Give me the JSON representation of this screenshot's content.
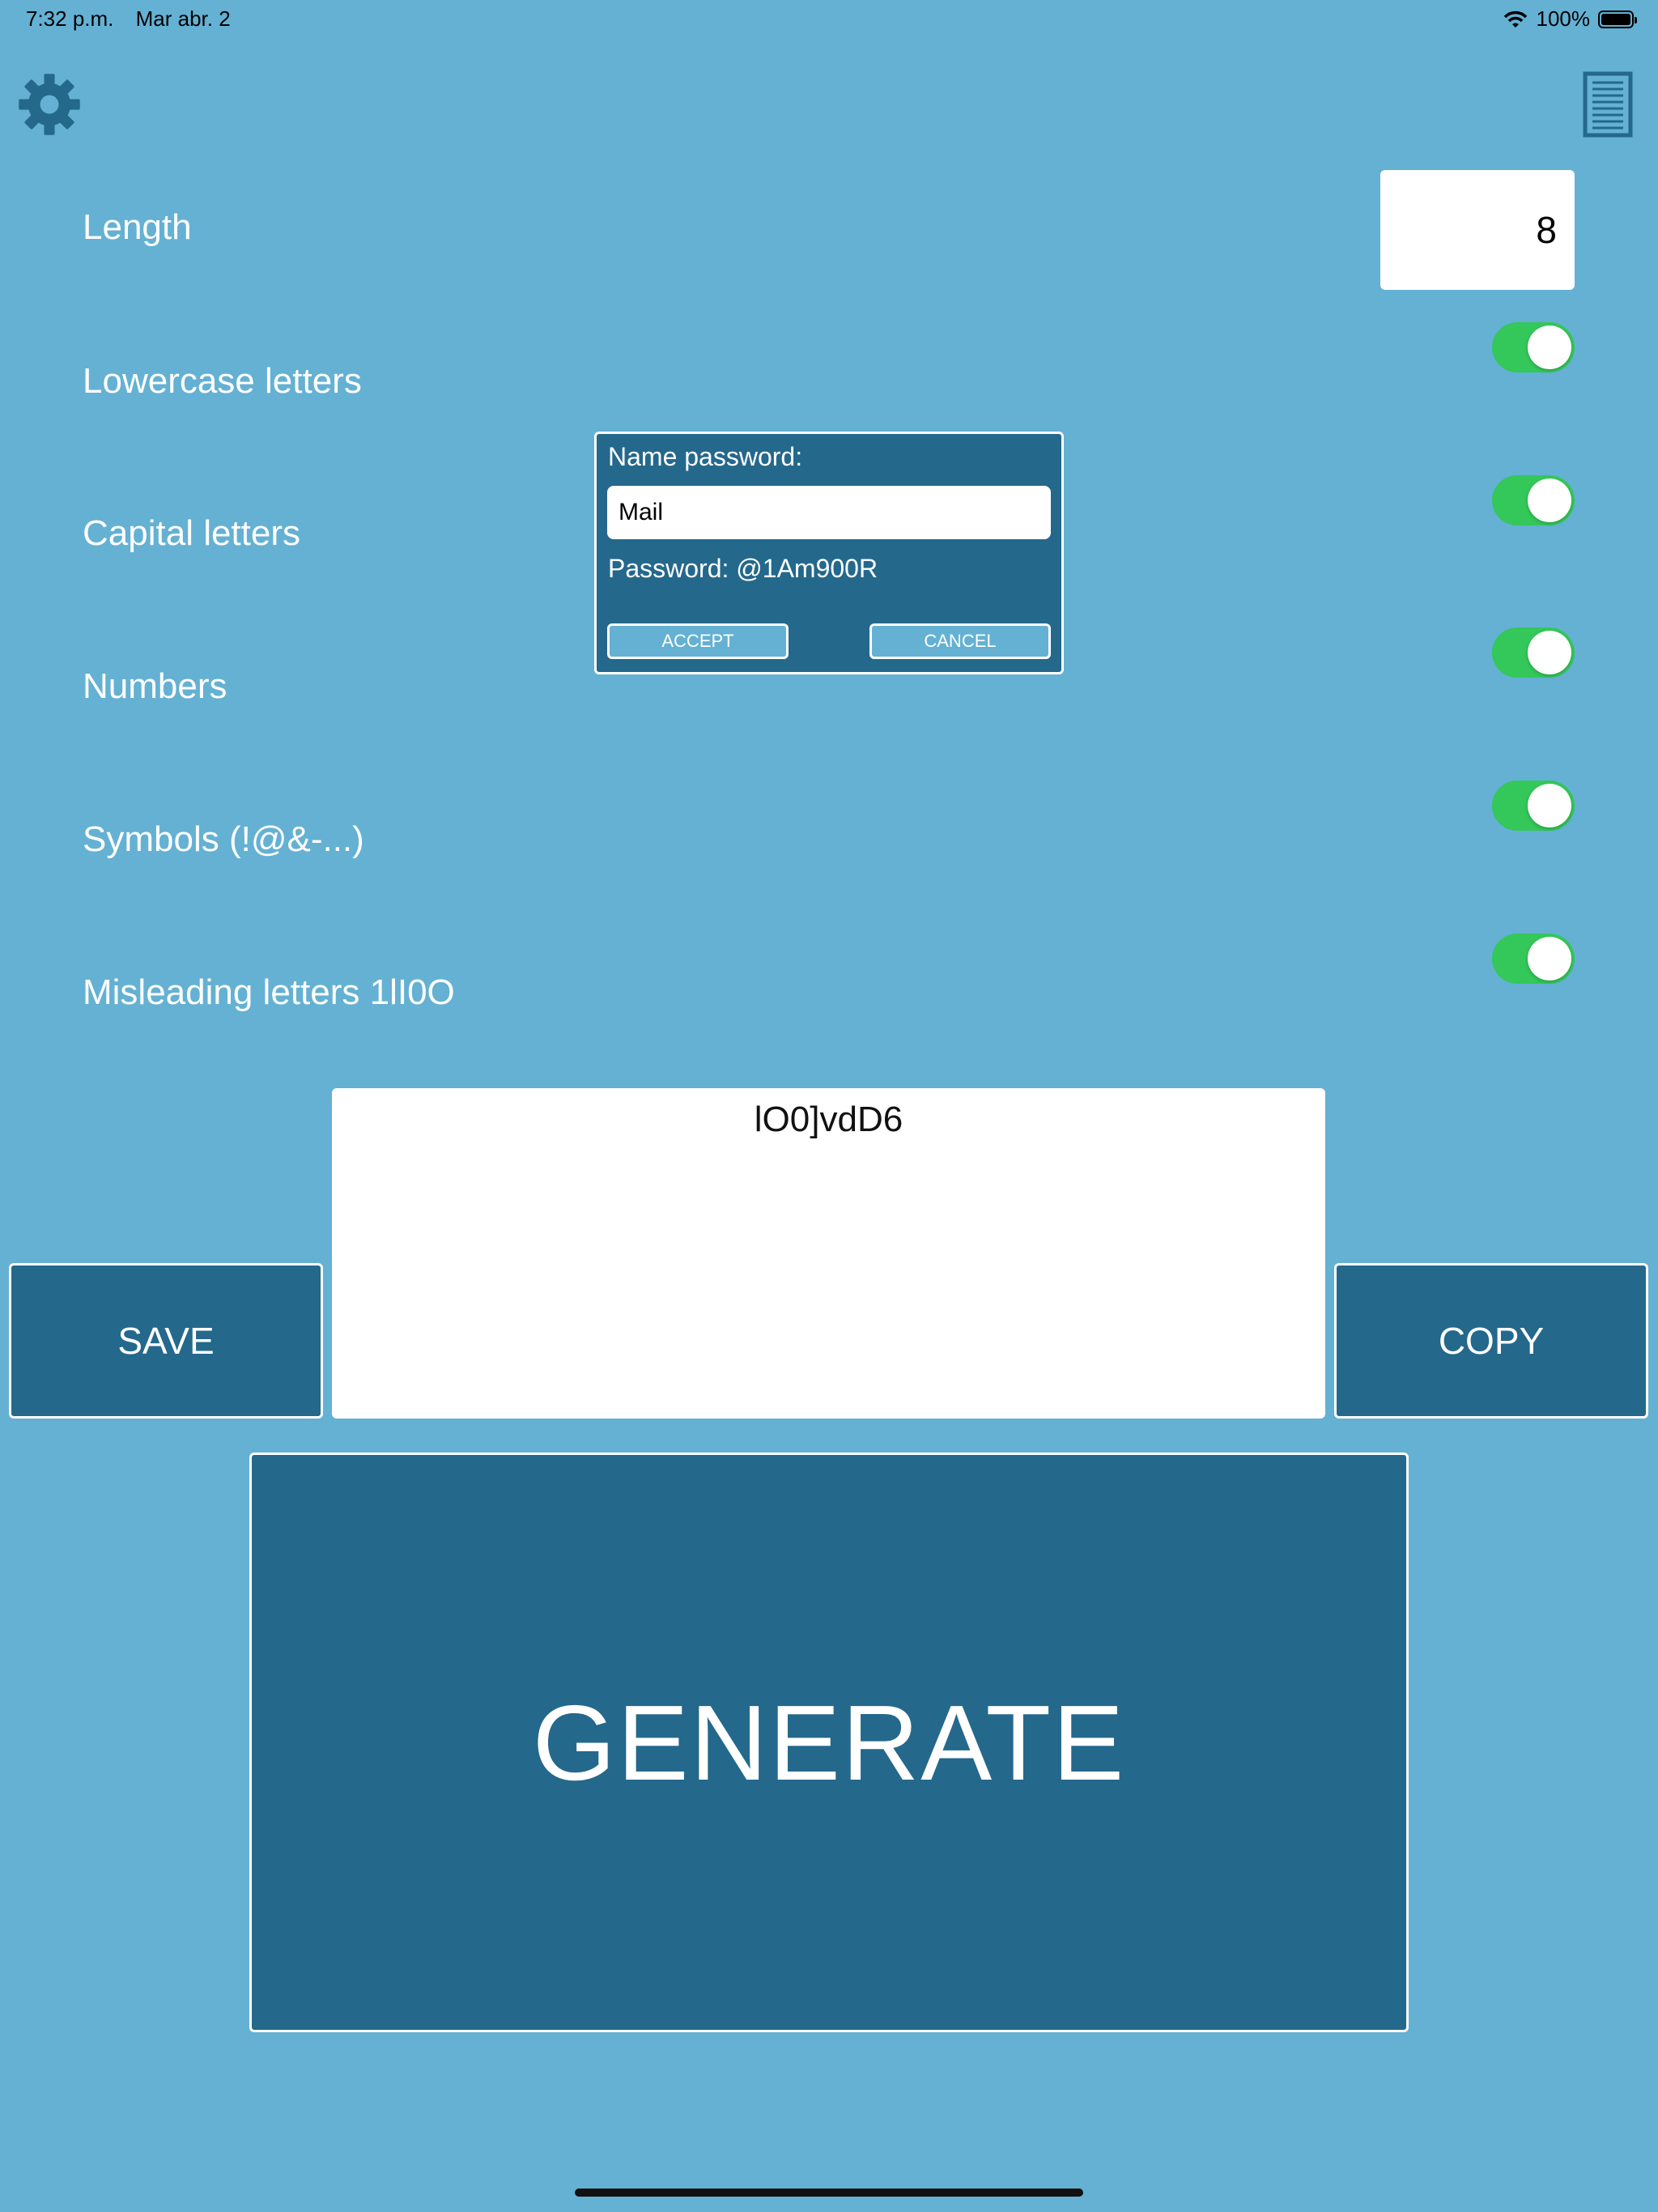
{
  "status_bar": {
    "time": "7:32 p.m.",
    "date": "Mar abr. 2",
    "battery_percent": "100%",
    "wifi_icon": "wifi-icon",
    "battery_icon": "battery-icon"
  },
  "toolbar": {
    "settings_icon": "gear-icon",
    "saved_list_icon": "document-list-icon"
  },
  "options": {
    "length_label": "Length",
    "length_value": "8",
    "lowercase_label": "Lowercase letters",
    "lowercase_on": true,
    "capitals_label": "Capital letters",
    "capitals_on": true,
    "numbers_label": "Numbers",
    "numbers_on": true,
    "symbols_label": "Symbols (!@&-...)",
    "symbols_on": true,
    "misleading_label": "Misleading letters 1lI0O",
    "misleading_on": true
  },
  "output": {
    "password": "lO0]vdD6"
  },
  "actions": {
    "save_label": "SAVE",
    "copy_label": "COPY",
    "generate_label": "GENERATE"
  },
  "dialog": {
    "title": "Name password:",
    "name_value": "Mail",
    "password_text": "Password: @1Am900R",
    "accept_label": "ACCEPT",
    "cancel_label": "CANCEL"
  },
  "colors": {
    "background": "#64b1d3",
    "button": "#24688c",
    "toggle_on": "#34c759"
  }
}
